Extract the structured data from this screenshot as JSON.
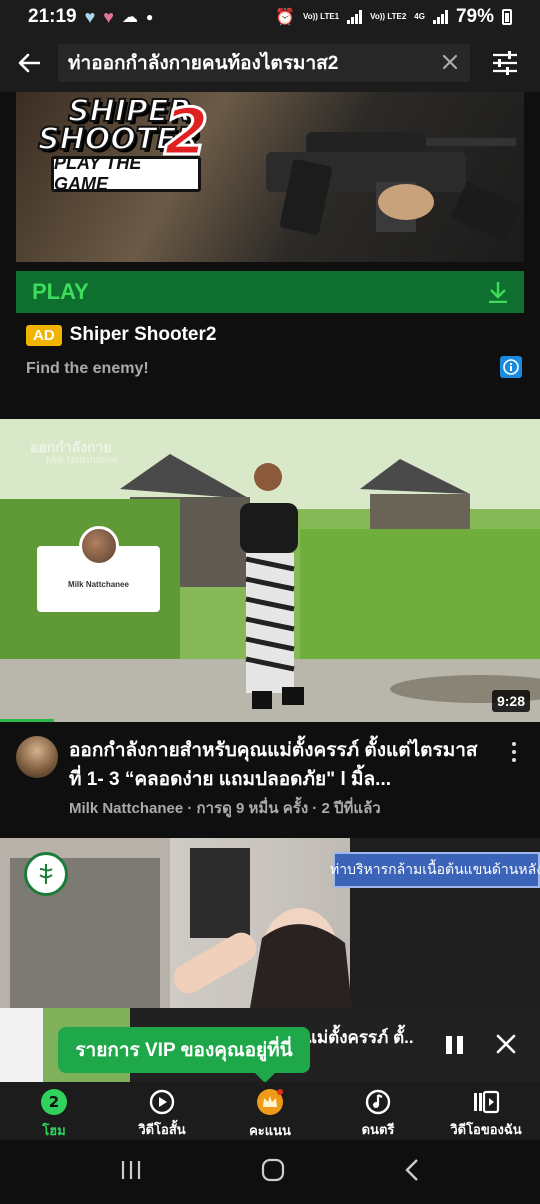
{
  "status_bar": {
    "time": "21:19",
    "net1": "Vo)) LTE1",
    "net2": "Vo)) LTE2",
    "net_type": "4G",
    "battery": "79%"
  },
  "search": {
    "query": "ท่าออกกำลังกายคนท้องไตรมาส2"
  },
  "ad": {
    "logo_line1": "SHIPER",
    "logo_line2": "SHOOTER",
    "logo_number": "2",
    "cta_image_text": "PLAY THE GAME",
    "play_label": "PLAY",
    "badge": "AD",
    "title": "Shiper Shooter2",
    "description": "Find the enemy!"
  },
  "video1": {
    "duration": "9:28",
    "watermark": "ออกกำลังกาย",
    "card_name": "Milk Nattchanee",
    "title": "ออกกำลังกายสำหรับคุณแม่ตั้งครรภ์ ตั้งแต่ไตรมาสที่ 1- 3 “คลอดง่าย แถมปลอดภัย\" l มิ้ล...",
    "channel": "Milk Nattchanee",
    "views": "การดู 9 หมื่น ครั้ง",
    "age": "2 ปีที่แล้ว",
    "progress_fraction": 0.1
  },
  "video2": {
    "banner": "ท่าบริหารกล้ามเนื้อต้นแขนด้านหลัง"
  },
  "mini_player": {
    "title": "แม่ตั้งครรภ์ ตั้..",
    "vip_text": "รายการ VIP ของคุณอยู่ที่นี่"
  },
  "bottom_nav": {
    "items": [
      {
        "label": "โฮม",
        "icon": "home-icon",
        "badge": "2"
      },
      {
        "label": "วิดีโอสั้น",
        "icon": "shorts-icon"
      },
      {
        "label": "คะแนน",
        "icon": "crown-icon"
      },
      {
        "label": "ดนตรี",
        "icon": "music-icon"
      },
      {
        "label": "วิดีโอของฉัน",
        "icon": "library-icon"
      }
    ]
  },
  "colors": {
    "background": "#0f0f0f",
    "accent_green": "#2fd35c",
    "play_bar": "#0f6f2e",
    "ad_badge": "#f0b400",
    "vip_bubble": "#1ea84a"
  }
}
